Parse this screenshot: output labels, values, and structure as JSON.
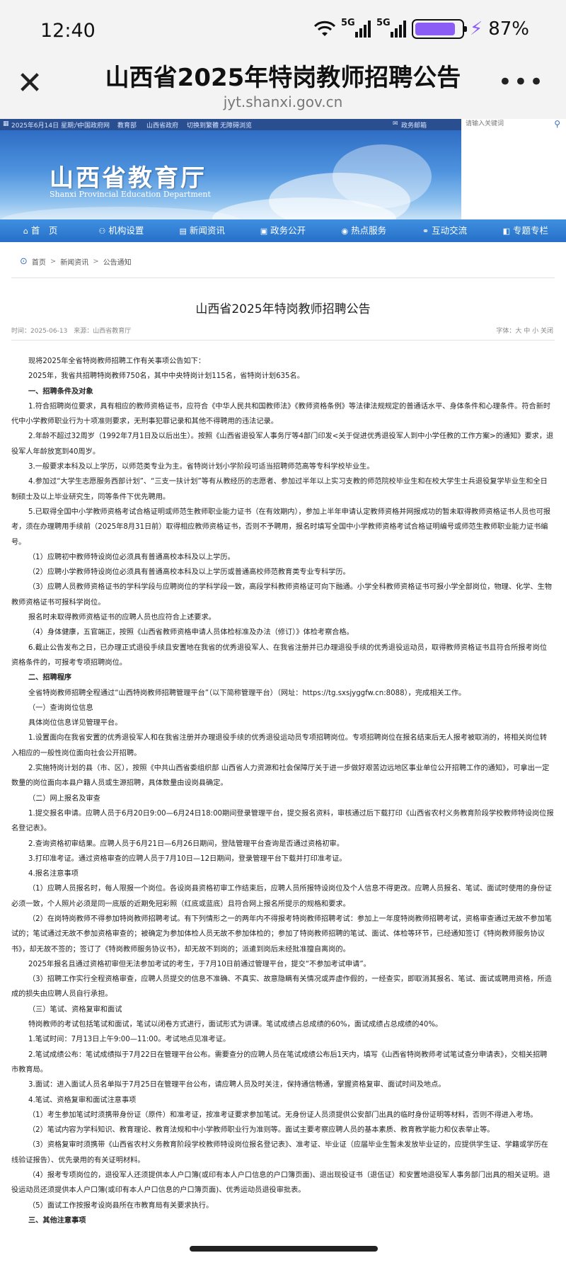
{
  "status": {
    "time": "12:40",
    "net1": "5G",
    "net2": "5G",
    "battery_pct": "87%",
    "battery_level": 0.87
  },
  "header": {
    "title": "山西省2025年特岗教师招聘公告",
    "url": "jyt.shanxi.gov.cn"
  },
  "topbar": {
    "date": "2025年6月14日 星期六",
    "links": [
      "中国政府网",
      "教育部",
      "山西省政府",
      "切换到繁體",
      "无障碍浏览",
      "政务邮箱"
    ],
    "search_placeholder": "请输入关键词"
  },
  "banner": {
    "name": "山西省教育厅",
    "name_en": "Shanxi Provincial Education Department"
  },
  "nav": [
    {
      "label": "首　页",
      "icon": "home-icon",
      "glyph": "⌂"
    },
    {
      "label": "机构设置",
      "icon": "org-chart-icon",
      "glyph": "⚇"
    },
    {
      "label": "新闻资讯",
      "icon": "news-icon",
      "glyph": "▤"
    },
    {
      "label": "政务公开",
      "icon": "government-icon",
      "glyph": "▣"
    },
    {
      "label": "热点服务",
      "icon": "hot-service-icon",
      "glyph": "◉"
    },
    {
      "label": "互动交流",
      "icon": "interaction-icon",
      "glyph": "⚭"
    },
    {
      "label": "专题专栏",
      "icon": "topic-icon",
      "glyph": "◧"
    }
  ],
  "breadcrumb": {
    "home": "首页",
    "section": "新闻资讯",
    "current": "公告通知",
    "sep": ">"
  },
  "article": {
    "title": "山西省2025年特岗教师招聘公告",
    "meta": "时间：2025-06-13　来源：山西省教育厅",
    "font_controls": "字体：大 中 小 关闭",
    "paragraphs": [
      "现将2025年全省特岗教师招聘工作有关事项公告如下：",
      "2025年，我省共招聘特岗教师750名，其中中央特岗计划115名，省特岗计划635名。",
      "一、招聘条件及对象",
      "1.符合招聘岗位要求，具有相应的教师资格证书，应符合《中华人民共和国教师法》《教师资格条例》等法律法规规定的普通话水平、身体条件和心理条件。符合新时代中小学教师职业行为十项准则要求，无刑事犯罪记录和其他不得聘用的违法记录。",
      "2.年龄不超过32周岁（1992年7月1日及以后出生）。按照《山西省退役军人事务厅等4部门印发<关于促进优秀退役军人到中小学任教的工作方案>的通知》要求，退役军人年龄放宽到40周岁。",
      "3.一般要求本科及以上学历，以师范类专业为主。省特岗计划小学阶段可适当招聘师范高等专科学校毕业生。",
      "4.参加过“大学生志愿服务西部计划”、“三支一扶计划”等有从教经历的志愿者、参加过半年以上实习支教的师范院校毕业生和在校大学生士兵退役复学毕业生和全日制硕士及以上毕业研究生，同等条件下优先聘用。",
      "5.已取得全国中小学教师资格考试合格证明或师范生教师职业能力证书（在有效期内），参加上半年申请认定教师资格并网报成功的暂未取得教师资格证书人员也可报考，须在办理聘用手续前（2025年8月31日前）取得相应教师资格证书，否则不予聘用，报名时填写全国中小学教师资格考试合格证明编号或师范生教师职业能力证书编号。",
      "（1）应聘初中教师特设岗位必须具有普通高校本科及以上学历。",
      "（2）应聘小学教师特设岗位必须具有普通高校本科及以上学历或普通高校师范教育类专业专科学历。",
      "（3）应聘人员教师资格证书的学科学段与应聘岗位的学科学段一致，高段学科教师资格证可向下融通。小学全科教师资格证书可报小学全部岗位，物理、化学、生物教师资格证书可报科学岗位。",
      "报名时未取得教师资格证书的应聘人员也应符合上述要求。",
      "（4）身体健康，五官端正，按照《山西省教师资格申请人员体检标准及办法（修订）》体检考察合格。",
      "6.截止公告发布之日，已办理正式退役手续且安置地在我省的优秀退役军人、在我省注册并已办理退役手续的优秀退役运动员，取得教师资格证书且符合所报考岗位资格条件的，可报考专项招聘岗位。",
      "二、招聘程序",
      "全省特岗教师招聘全程通过“山西特岗教师招聘管理平台”（以下简称管理平台）（网址：https://tg.sxsjyggfw.cn:8088），完成相关工作。",
      "（一）查询岗位信息",
      "具体岗位信息详见管理平台。",
      "1.设置面向在我省安置的优秀退役军人和在我省注册并办理退役手续的优秀退役运动员专项招聘岗位。专项招聘岗位在报名结束后无人报考被取消的，将相关岗位转入相应的一般性岗位面向社会公开招聘。",
      "2.实施特岗计划的县（市、区），按照《中共山西省委组织部 山西省人力资源和社会保障厅关于进一步做好艰苦边远地区事业单位公开招聘工作的通知》，可拿出一定数量的岗位面向本县户籍人员或生源招聘，具体数量由设岗县确定。",
      "（二）网上报名及审查",
      "1.提交报名申请。应聘人员于6月20日9:00—6月24日18:00期间登录管理平台，提交报名资料，审核通过后下载打印《山西省农村义务教育阶段学校教师特设岗位报名登记表》。",
      "2.查询资格初审结果。应聘人员于6月21日—6月26日期间，登陆管理平台查询是否通过资格初审。",
      "3.打印准考证。通过资格审查的应聘人员于7月10日—12日期间，登录管理平台下载并打印准考证。",
      "4.报名注意事项",
      "（1）应聘人员报名时，每人限报一个岗位。各设岗县资格初审工作结束后，应聘人员所报特设岗位及个人信息不得更改。应聘人员报名、笔试、面试时使用的身份证必须一致，个人照片必须是同一底版的近期免冠彩照（红底或蓝底）且符合网上报名所提示的规格和要求。",
      "（2）在岗特岗教师不得参加特岗教师招聘考试。有下列情形之一的两年内不得报考特岗教师招聘考试：参加上一年度特岗教师招聘考试，资格审查通过无故不参加笔试的；笔试通过无故不参加资格审查的；被确定为参加体检人员无故不参加体检的；参加了特岗教师招聘的笔试、面试、体检等环节，已经通知签订《特岗教师服务协议书》，却无故不签的；签订了《特岗教师服务协议书》，却无故不到岗的；派遣到岗后未经批准擅自离岗的。",
      "2025年报名且通过资格初审但无法参加考试的考生，于7月10日前通过管理平台，提交“不参加考试申请”。",
      "（3）招聘工作实行全程资格审查，应聘人员提交的信息不准确、不真实、故意隐瞒有关情况或弄虚作假的，一经查实，即取消其报名、笔试、面试或聘用资格，所造成的损失由应聘人员自行承担。",
      "（三）笔试、资格复审和面试",
      "特岗教师的考试包括笔试和面试，笔试以闭卷方式进行，面试形式为讲课。笔试成绩占总成绩的60%，面试成绩占总成绩的40%。",
      "1.笔试时间：7月13日上午9:00—11:00。考试地点见准考证。",
      "2.笔试成绩公布：笔试成绩拟于7月22日在管理平台公布。需要查分的应聘人员在笔试成绩公布后1天内，填写《山西省特岗教师考试笔试查分申请表》，交相关招聘市教育局。",
      "3.面试：进入面试人员名单拟于7月25日在管理平台公布，请应聘人员及时关注，保持通信畅通，掌握资格复审、面试时间及地点。",
      "4.笔试、资格复审和面试注意事项",
      "（1）考生参加笔试时须携带身份证（原件）和准考证，按准考证要求参加笔试。无身份证人员须提供公安部门出具的临时身份证明等材料，否则不得进入考场。",
      "（2）笔试内容为学科知识、教育理论、教育法规和中小学教师职业行为准则等。面试主要考察应聘人员的基本素质、教育教学能力和仪表举止等。",
      "（3）资格复审时须携带《山西省农村义务教育阶段学校教师特设岗位报名登记表》、准考证、毕业证（应届毕业生暂未发放毕业证的，应提供学生证、学籍或学历在线验证报告）、优先录用的有关证明材料。",
      "（4）报考专项岗位的，退役军人还须提供本人户口簿(或印有本人户口信息的户口簿页面)、退出现役证书（退伍证）和安置地退役军人事务部门出具的相关证明。退役运动员还须提供本人户口簿(或印有本人户口信息的户口簿页面)、优秀运动员退役审批表。",
      "（5）面试工作按报考设岗县所在市教育局有关要求执行。",
      "三、其他注意事项"
    ]
  },
  "colors": {
    "brand_blue": "#2670c8",
    "topline": "#2a4f90",
    "battery": "#8b5cf6"
  }
}
